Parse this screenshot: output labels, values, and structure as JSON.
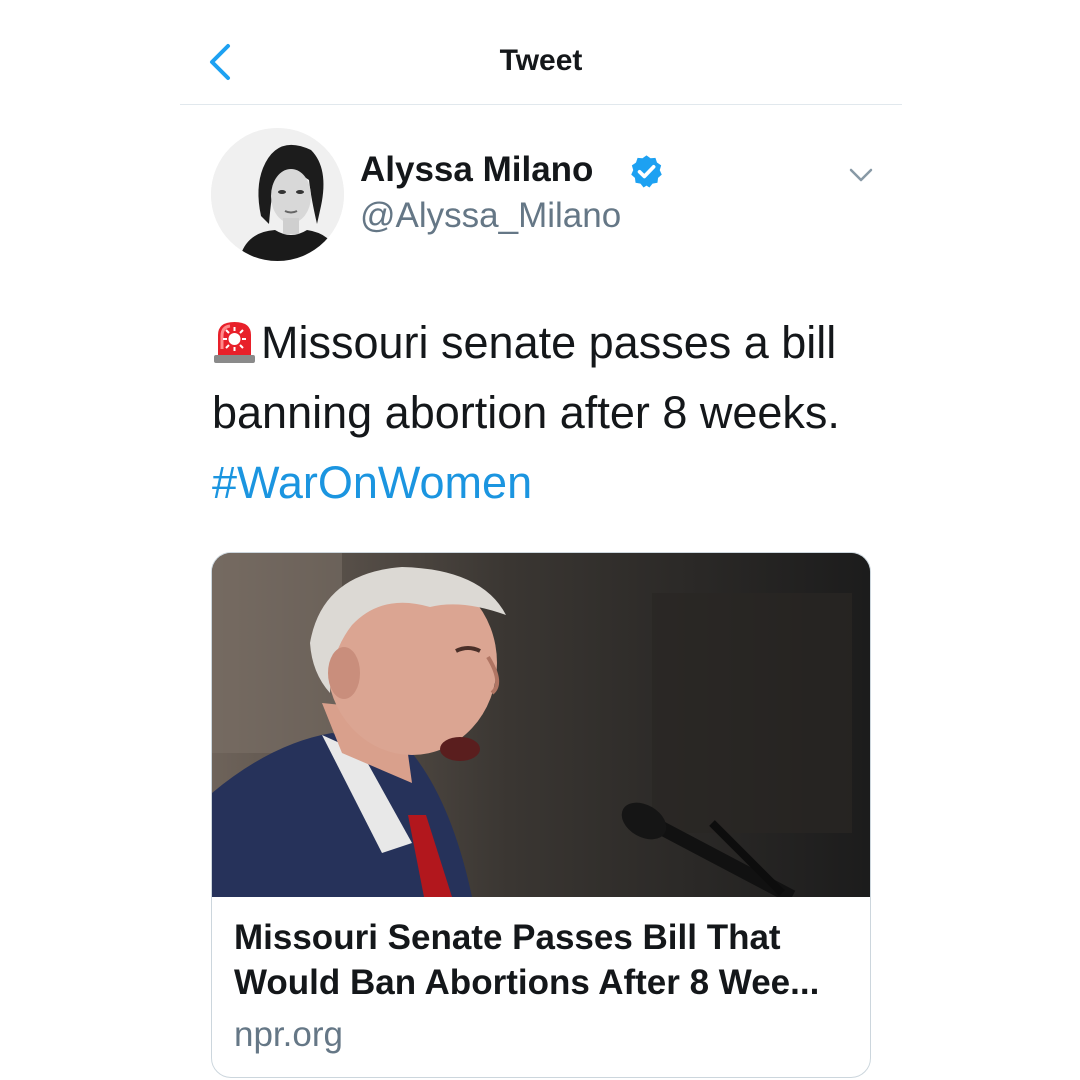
{
  "header": {
    "title": "Tweet",
    "back_icon": "chevron-left-icon"
  },
  "author": {
    "display_name": "Alyssa Milano",
    "handle": "@Alyssa_Milano",
    "verified_icon": "verified-badge-icon",
    "menu_icon": "chevron-down-icon"
  },
  "tweet": {
    "emoji_icon": "siren-emoji-icon",
    "text": "Missouri senate passes a bill banning abortion after 8 weeks.",
    "hashtag": "#WarOnWomen"
  },
  "card": {
    "image": "photo-speaker-at-microphone",
    "title": "Missouri Senate Passes Bill That Would Ban Abortions After 8 Wee...",
    "domain": "npr.org"
  },
  "colors": {
    "link_blue": "#1b95e0",
    "text_primary": "#14171a",
    "text_secondary": "#657786",
    "verified_blue": "#1da1f2"
  }
}
